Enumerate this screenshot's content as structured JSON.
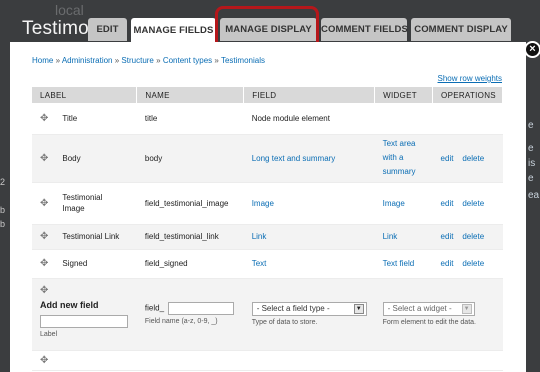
{
  "background": {
    "page_title": "Testimoni",
    "ghost_text": "local",
    "side_text": [
      "2",
      "b",
      "b"
    ],
    "right_text": [
      "e",
      "e is",
      "e",
      "ea"
    ]
  },
  "tabs": [
    {
      "label": "EDIT",
      "active": false
    },
    {
      "label": "MANAGE FIELDS",
      "active": true
    },
    {
      "label": "MANAGE DISPLAY",
      "active": false
    },
    {
      "label": "COMMENT FIELDS",
      "active": false
    },
    {
      "label": "COMMENT DISPLAY",
      "active": false
    }
  ],
  "close_label": "×",
  "breadcrumb": {
    "items": [
      "Home",
      "Administration",
      "Structure",
      "Content types",
      "Testimonials"
    ],
    "separator": "»"
  },
  "row_weights_link": "Show row weights",
  "table": {
    "columns": [
      "LABEL",
      "NAME",
      "FIELD",
      "WIDGET",
      "OPERATIONS"
    ],
    "rows": [
      {
        "label": "Title",
        "name": "title",
        "field": "Node module element",
        "widget": "",
        "edit": "",
        "delete": ""
      },
      {
        "label": "Body",
        "name": "body",
        "field": "Long text and summary",
        "widget": "Text area with a summary",
        "edit": "edit",
        "delete": "delete"
      },
      {
        "label": "Testimonial Image",
        "name": "field_testimonial_image",
        "field": "Image",
        "widget": "Image",
        "edit": "edit",
        "delete": "delete"
      },
      {
        "label": "Testimonial Link",
        "name": "field_testimonial_link",
        "field": "Link",
        "widget": "Link",
        "edit": "edit",
        "delete": "delete"
      },
      {
        "label": "Signed",
        "name": "field_signed",
        "field": "Text",
        "widget": "Text field",
        "edit": "edit",
        "delete": "delete"
      }
    ]
  },
  "add_new": {
    "title": "Add new field",
    "label_desc": "Label",
    "field_prefix": "field_",
    "field_name_desc": "Field name (a-z, 0-9, _)",
    "field_type_placeholder": "- Select a field type -",
    "field_type_desc": "Type of data to store.",
    "widget_placeholder": "- Select a widget -",
    "widget_desc": "Form element to edit the data."
  },
  "icons": {
    "drag_handle": "✥",
    "select_arrow": "▼"
  }
}
